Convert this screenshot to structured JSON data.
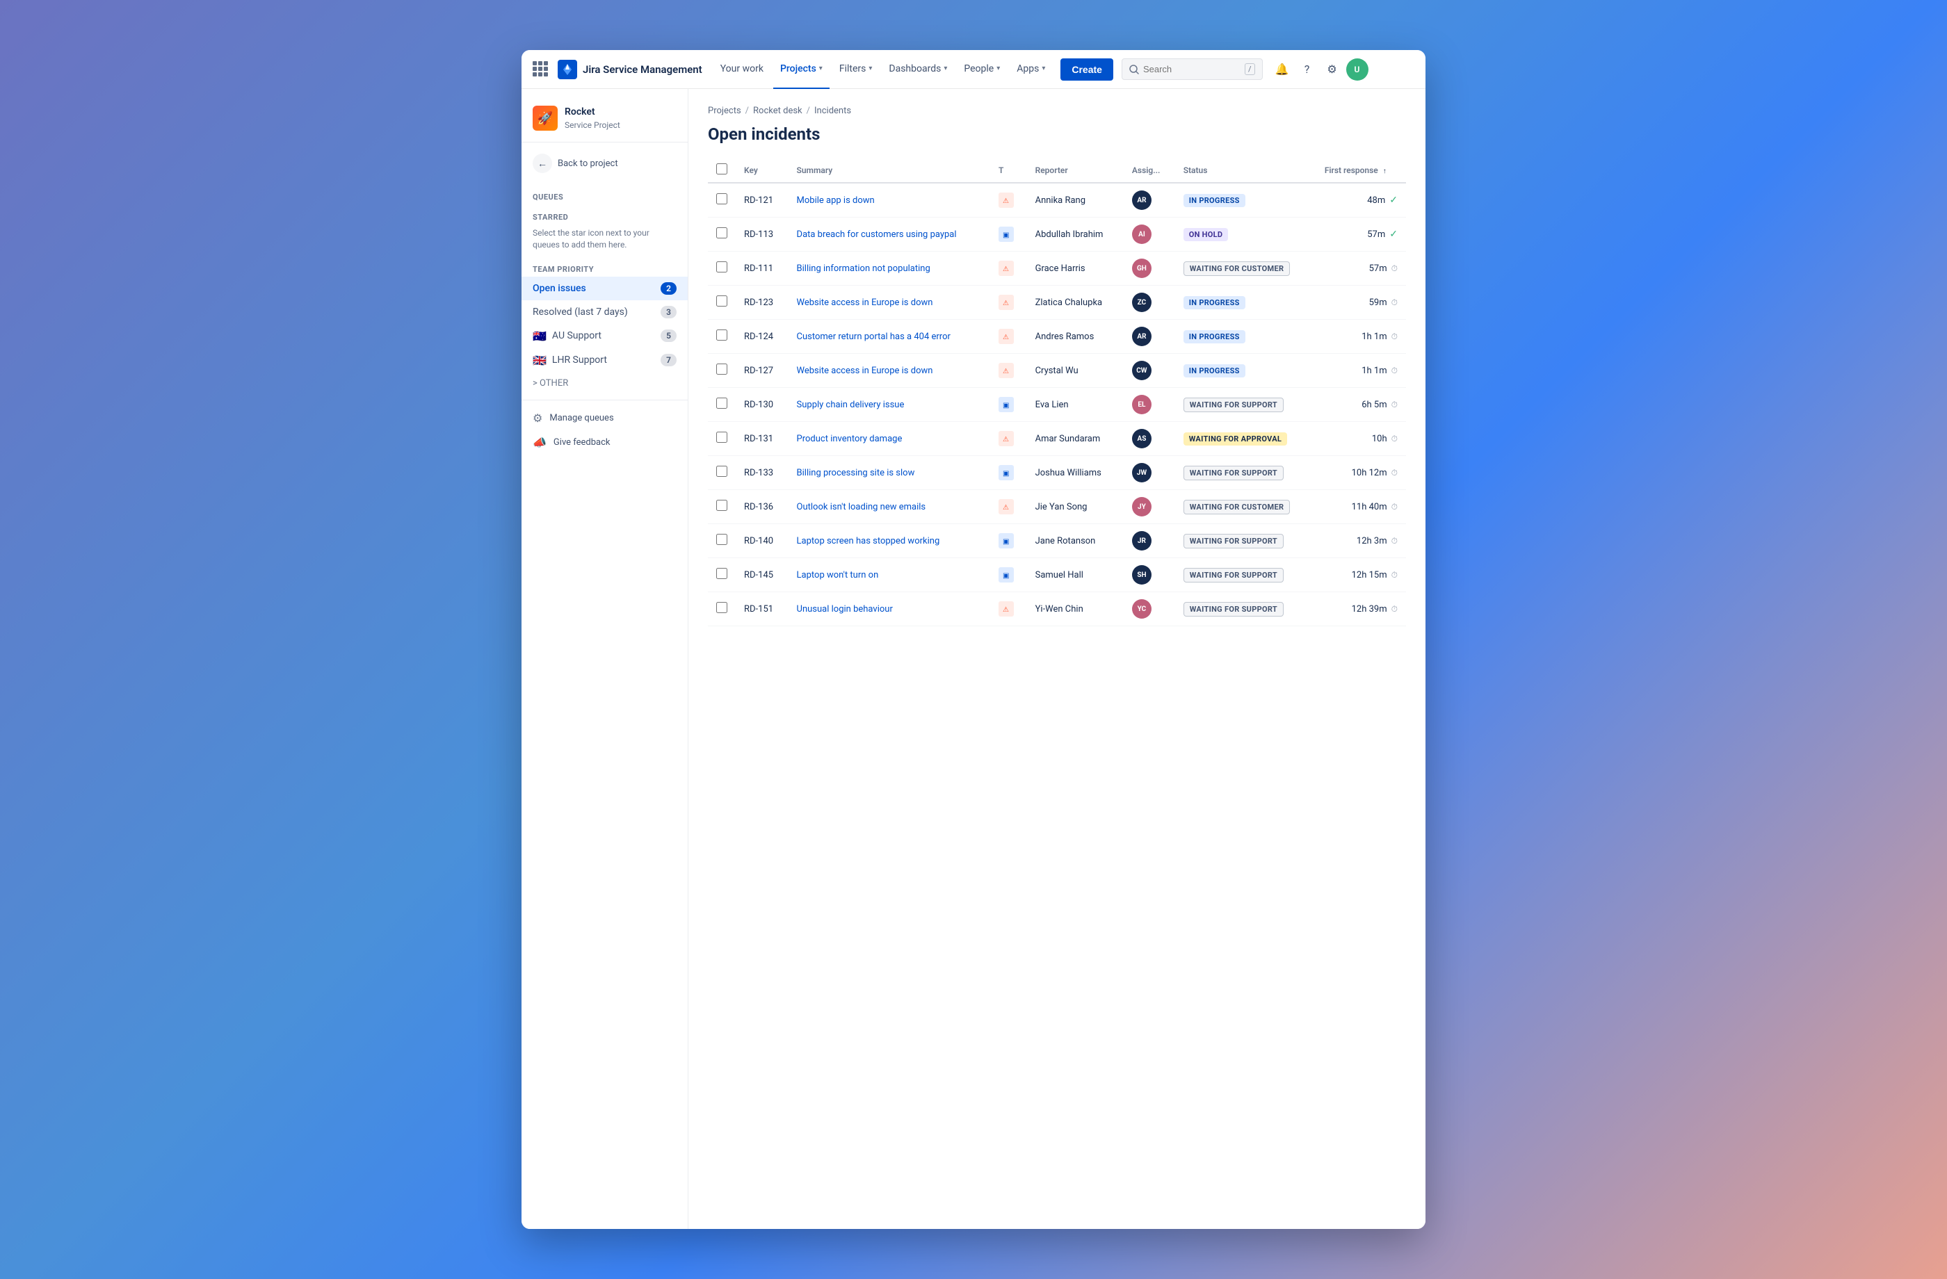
{
  "app": {
    "name": "Jira Service Management"
  },
  "topnav": {
    "brand": "Jira Service Management",
    "your_work": "Your work",
    "projects": "Projects",
    "filters": "Filters",
    "dashboards": "Dashboards",
    "people": "People",
    "apps": "Apps",
    "create": "Create",
    "search_placeholder": "Search"
  },
  "sidebar": {
    "project_name": "Rocket",
    "project_type": "Service Project",
    "back_label": "Back to project",
    "queues_label": "Queues",
    "starred_label": "STARRED",
    "starred_desc": "Select the star icon next to your queues to add them here.",
    "team_priority_label": "TEAM PRIORITY",
    "open_issues_label": "Open issues",
    "open_issues_count": "2",
    "resolved_label": "Resolved (last 7 days)",
    "resolved_count": "3",
    "au_support_label": "AU Support",
    "au_support_count": "5",
    "lhr_support_label": "LHR Support",
    "lhr_support_count": "7",
    "other_label": "> OTHER",
    "manage_queues_label": "Manage queues",
    "give_feedback_label": "Give feedback"
  },
  "breadcrumb": {
    "projects": "Projects",
    "rocket_desk": "Rocket desk",
    "incidents": "Incidents"
  },
  "page": {
    "title": "Open incidents"
  },
  "table": {
    "headers": {
      "key": "Key",
      "summary": "Summary",
      "type": "T",
      "reporter": "Reporter",
      "assignee": "Assig...",
      "status": "Status",
      "first_response": "First response"
    },
    "rows": [
      {
        "key": "RD-121",
        "summary": "Mobile app is down",
        "type": "incident",
        "reporter": "Annika Rang",
        "assignee_initials": "AR",
        "assignee_color": "av-darkblue",
        "status": "IN PROGRESS",
        "status_class": "status-inprogress",
        "time": "48m",
        "time_icon": "check"
      },
      {
        "key": "RD-113",
        "summary": "Data breach for customers using paypal",
        "type": "service",
        "reporter": "Abdullah Ibrahim",
        "assignee_initials": "AI",
        "assignee_color": "av-pink",
        "status": "ON HOLD",
        "status_class": "status-onhold",
        "time": "57m",
        "time_icon": "check"
      },
      {
        "key": "RD-111",
        "summary": "Billing information not populating",
        "type": "incident",
        "reporter": "Grace Harris",
        "assignee_initials": "GH",
        "assignee_color": "av-pink",
        "status": "WAITING FOR CUSTOMER",
        "status_class": "status-waiting-customer",
        "time": "57m",
        "time_icon": "clock"
      },
      {
        "key": "RD-123",
        "summary": "Website access in Europe is down",
        "type": "incident",
        "reporter": "Zlatica Chalupka",
        "assignee_initials": "ZC",
        "assignee_color": "av-darkblue",
        "status": "IN PROGRESS",
        "status_class": "status-inprogress",
        "time": "59m",
        "time_icon": "clock"
      },
      {
        "key": "RD-124",
        "summary": "Customer return portal has a 404 error",
        "type": "incident",
        "reporter": "Andres Ramos",
        "assignee_initials": "AR",
        "assignee_color": "av-darkblue",
        "status": "IN PROGRESS",
        "status_class": "status-inprogress",
        "time": "1h 1m",
        "time_icon": "clock"
      },
      {
        "key": "RD-127",
        "summary": "Website access in Europe is down",
        "type": "incident",
        "reporter": "Crystal Wu",
        "assignee_initials": "CW",
        "assignee_color": "av-darkblue",
        "status": "IN PROGRESS",
        "status_class": "status-inprogress",
        "time": "1h 1m",
        "time_icon": "clock"
      },
      {
        "key": "RD-130",
        "summary": "Supply chain delivery issue",
        "type": "service",
        "reporter": "Eva Lien",
        "assignee_initials": "EL",
        "assignee_color": "av-pink",
        "status": "WAITING FOR SUPPORT",
        "status_class": "status-waiting-support",
        "time": "6h 5m",
        "time_icon": "clock"
      },
      {
        "key": "RD-131",
        "summary": "Product inventory damage",
        "type": "incident",
        "reporter": "Amar Sundaram",
        "assignee_initials": "AS",
        "assignee_color": "av-darkblue",
        "status": "WAITING FOR APPROVAL",
        "status_class": "status-waiting-approval",
        "time": "10h",
        "time_icon": "clock"
      },
      {
        "key": "RD-133",
        "summary": "Billing processing site is slow",
        "type": "service",
        "reporter": "Joshua Williams",
        "assignee_initials": "JW",
        "assignee_color": "av-darkblue",
        "status": "WAITING FOR SUPPORT",
        "status_class": "status-waiting-support",
        "time": "10h 12m",
        "time_icon": "clock"
      },
      {
        "key": "RD-136",
        "summary": "Outlook isn't loading new emails",
        "type": "incident",
        "reporter": "Jie Yan Song",
        "assignee_initials": "JY",
        "assignee_color": "av-pink",
        "status": "WAITING FOR CUSTOMER",
        "status_class": "status-waiting-customer",
        "time": "11h 40m",
        "time_icon": "clock"
      },
      {
        "key": "RD-140",
        "summary": "Laptop screen has stopped working",
        "type": "service",
        "reporter": "Jane Rotanson",
        "assignee_initials": "JR",
        "assignee_color": "av-darkblue",
        "status": "WAITING FOR SUPPORT",
        "status_class": "status-waiting-support",
        "time": "12h 3m",
        "time_icon": "clock"
      },
      {
        "key": "RD-145",
        "summary": "Laptop won't turn on",
        "type": "service",
        "reporter": "Samuel Hall",
        "assignee_initials": "SH",
        "assignee_color": "av-darkblue",
        "status": "WAITING FOR SUPPORT",
        "status_class": "status-waiting-support",
        "time": "12h 15m",
        "time_icon": "clock"
      },
      {
        "key": "RD-151",
        "summary": "Unusual login behaviour",
        "type": "incident",
        "reporter": "Yi-Wen Chin",
        "assignee_initials": "YC",
        "assignee_color": "av-pink",
        "status": "WAITING FOR SUPPORT",
        "status_class": "status-waiting-support",
        "time": "12h 39m",
        "time_icon": "clock"
      }
    ]
  }
}
